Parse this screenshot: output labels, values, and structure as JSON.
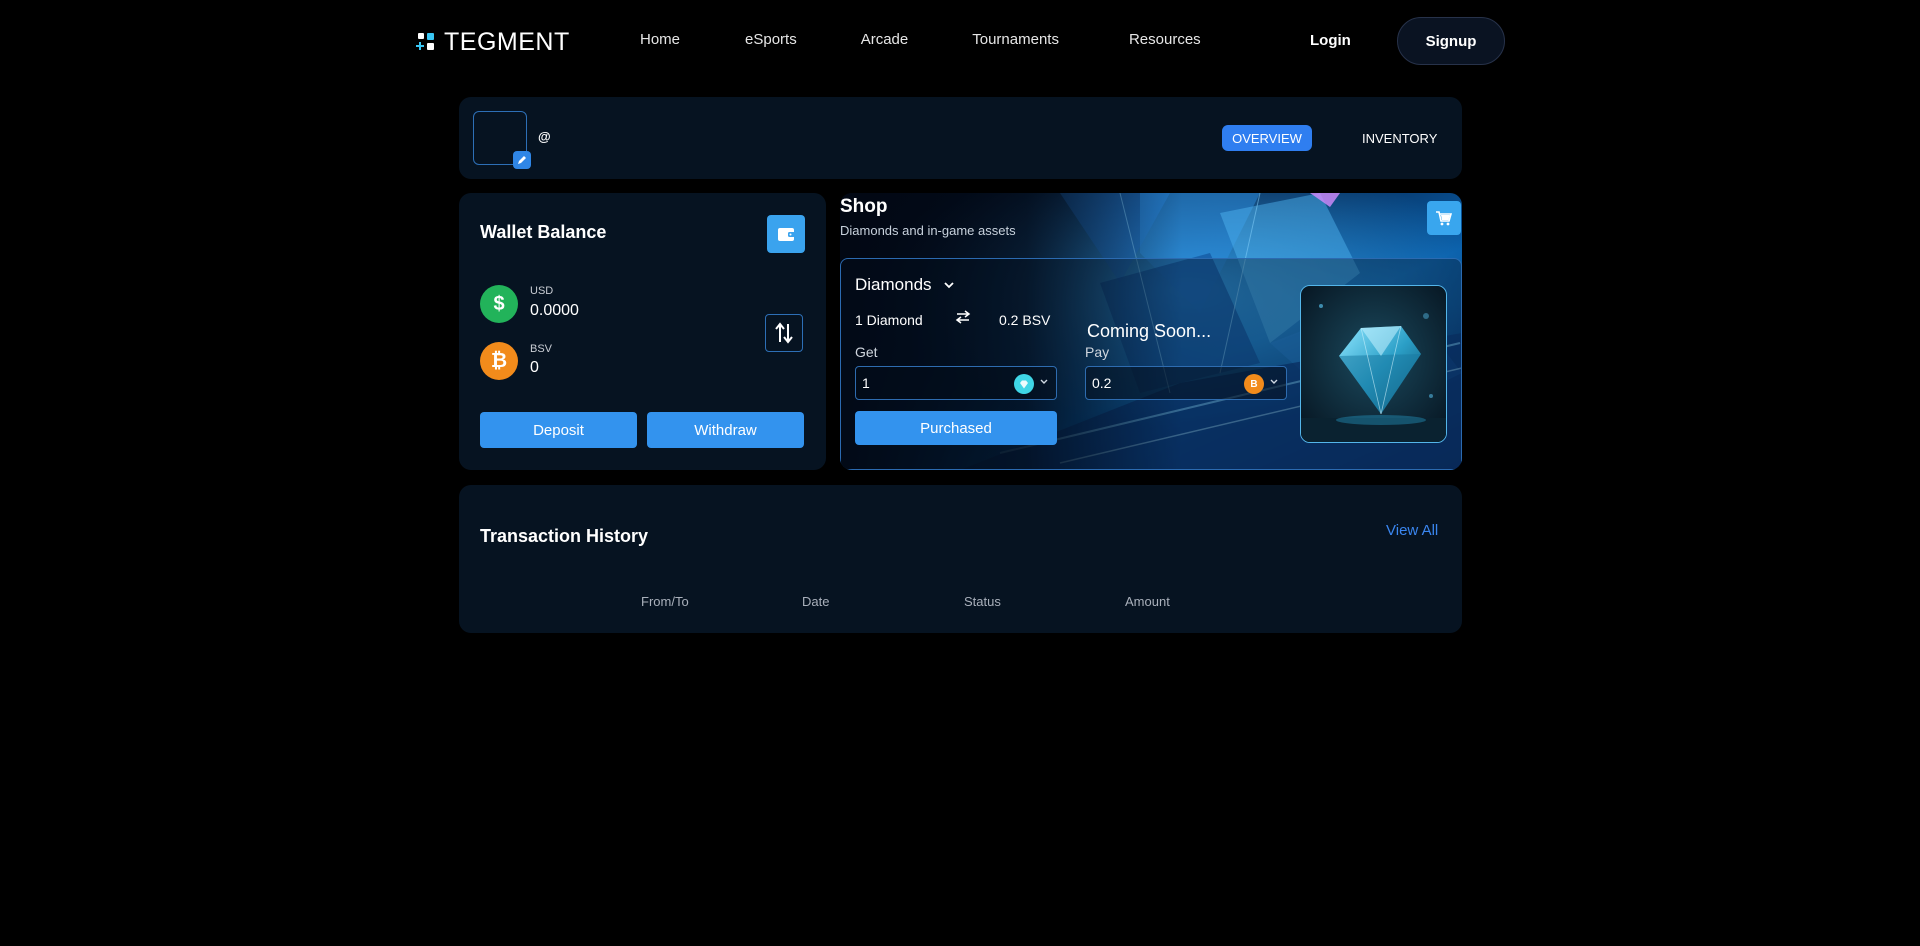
{
  "brand": {
    "name": "TEGMENT",
    "accent": "#39c6f4"
  },
  "nav": {
    "links": [
      "Home",
      "eSports",
      "Arcade",
      "Tournaments",
      "Resources"
    ],
    "login": "Login",
    "signup": "Signup"
  },
  "profile": {
    "handle": "@",
    "tabs": {
      "overview": "OVERVIEW",
      "inventory": "INVENTORY"
    },
    "icons": {
      "edit": "pencil-icon"
    }
  },
  "wallet": {
    "title": "Wallet Balance",
    "usd": {
      "label": "USD",
      "value": "0.0000",
      "symbol": "$",
      "color": "#22b35a"
    },
    "bsv": {
      "label": "BSV",
      "value": "0",
      "symbol": "₿",
      "color": "#f28b1b"
    },
    "deposit": "Deposit",
    "withdraw": "Withdraw",
    "icons": {
      "wallet": "wallet-icon",
      "swap": "swap-vertical-icon"
    }
  },
  "shop": {
    "title": "Shop",
    "subtitle": "Diamonds and in-game assets",
    "selector": "Diamonds",
    "rate_left": "1 Diamond",
    "rate_right": "0.2 BSV",
    "coming_soon": "Coming Soon...",
    "get_label": "Get",
    "get_value": "1",
    "pay_label": "Pay",
    "pay_value": "0.2",
    "pay_coin": "B",
    "purchased": "Purchased",
    "icons": {
      "cart": "cart-icon",
      "exchange": "exchange-arrows-icon"
    }
  },
  "transactions": {
    "title": "Transaction History",
    "view_all": "View All",
    "columns": [
      "From/To",
      "Date",
      "Status",
      "Amount"
    ]
  }
}
